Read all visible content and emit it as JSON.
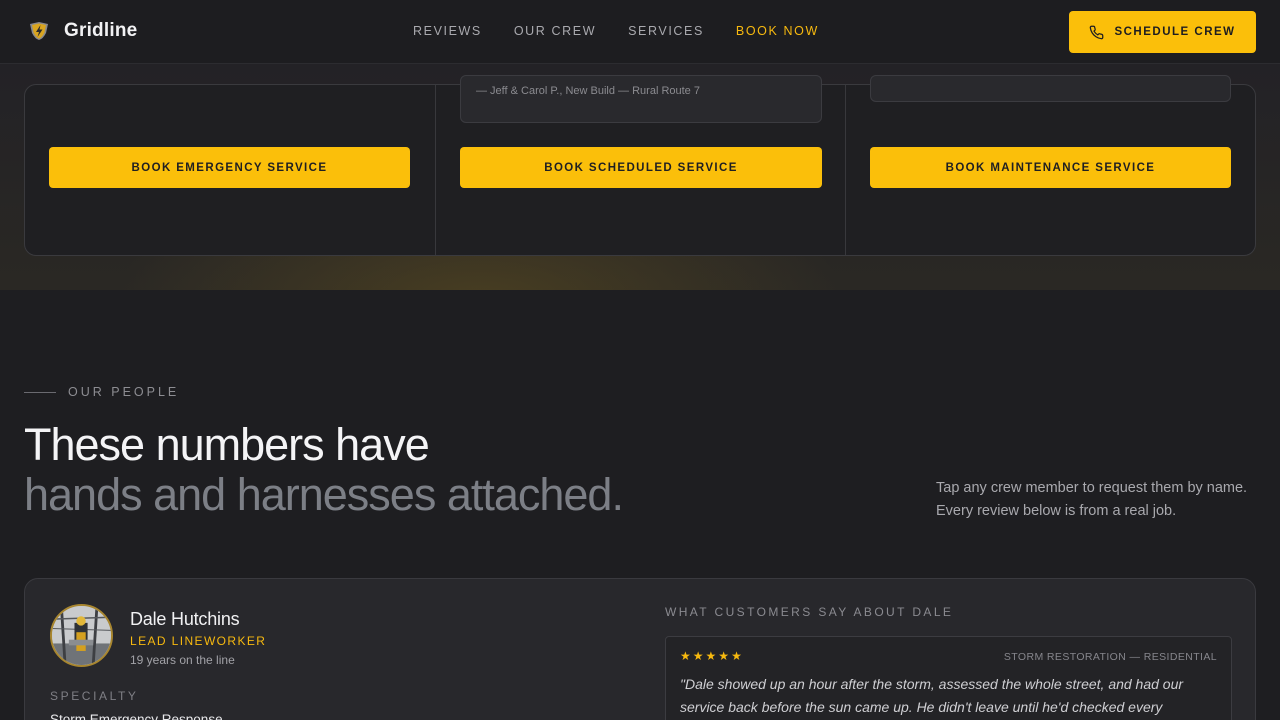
{
  "header": {
    "brand": "Gridline",
    "nav": [
      "REVIEWS",
      "OUR CREW",
      "SERVICES",
      "BOOK NOW"
    ],
    "active_nav": "BOOK NOW",
    "cta_label": "SCHEDULE CREW",
    "accent_color": "#fbbf0a"
  },
  "services": {
    "quote_attribution": "— Jeff & Carol P., New Build — Rural Route 7",
    "buttons": [
      "BOOK EMERGENCY SERVICE",
      "BOOK SCHEDULED SERVICE",
      "BOOK MAINTENANCE SERVICE"
    ]
  },
  "people": {
    "eyebrow": "OUR PEOPLE",
    "headline_line1": "These numbers have",
    "headline_line2": "hands and harnesses attached.",
    "intro_line1": "Tap any crew member to request them by name.",
    "intro_line2": "Every review below is from a real job."
  },
  "crew": {
    "name": "Dale Hutchins",
    "role": "LEAD LINEWORKER",
    "years": "19 years on the line",
    "specialty_label": "SPECIALTY",
    "specialty_value": "Storm Emergency Response",
    "reviews_label": "WHAT CUSTOMERS SAY ABOUT DALE",
    "review": {
      "stars": 5,
      "tag": "STORM RESTORATION — RESIDENTIAL",
      "text_line1": "\"Dale showed up an hour after the storm, assessed the whole street, and had our",
      "text_line2": "service back before the sun came up. He didn't leave until he'd checked every"
    }
  }
}
